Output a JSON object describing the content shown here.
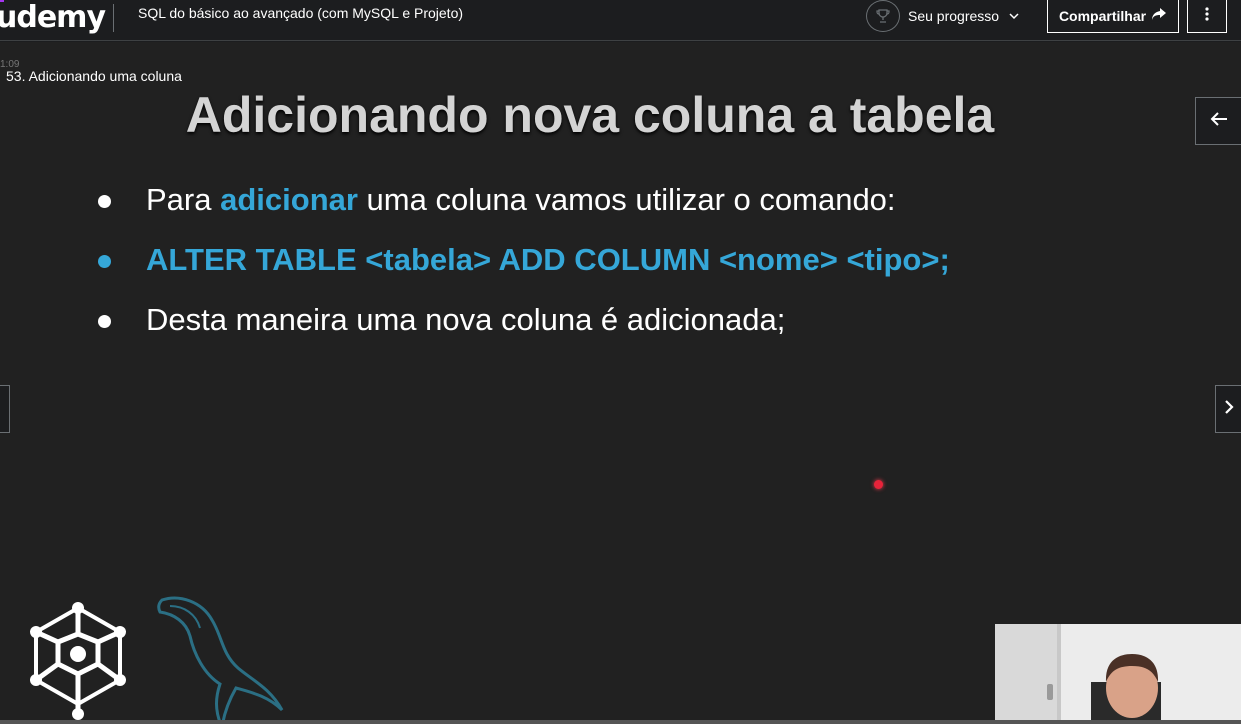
{
  "header": {
    "logo_text": "udemy",
    "course_title": "SQL do básico ao avançado (com MySQL e Projeto)",
    "progress_label": "Seu progresso",
    "share_label": "Compartilhar"
  },
  "video": {
    "timestamp": "1:09",
    "lecture_title": "53. Adicionando uma coluna",
    "slide": {
      "title": "Adicionando nova coluna a tabela",
      "bullet1": {
        "before": "Para ",
        "highlight": "adicionar",
        "after": " uma coluna vamos utilizar o comando:"
      },
      "bullet2": "ALTER TABLE <tabela> ADD COLUMN <nome> <tipo>;",
      "bullet3": "Desta maneira uma nova coluna é adicionada;"
    }
  },
  "colors": {
    "background": "#1c1d1f",
    "slide_background": "#212121",
    "accent_blue": "#35a7d8",
    "laser_red": "#e8233a",
    "brand_purple": "#a435f0"
  },
  "icons": {
    "trophy": "trophy-icon",
    "chevron": "chevron-down-icon",
    "share": "share-arrow-icon",
    "menu": "more-vertical-icon",
    "back": "arrow-left-icon",
    "next": "chevron-right-icon"
  }
}
